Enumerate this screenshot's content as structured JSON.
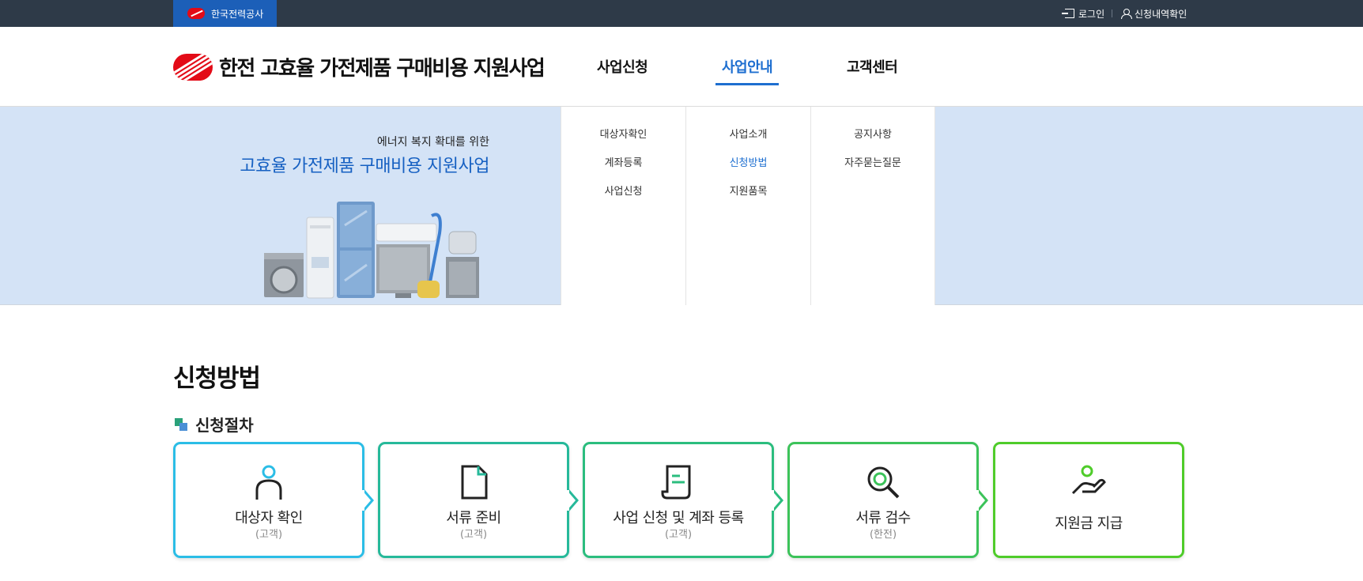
{
  "topbar": {
    "org": "한국전력공사",
    "login": "로그인",
    "history": "신청내역확인"
  },
  "header": {
    "logo_text": "한전 고효율 가전제품 구매비용 지원사업",
    "nav": [
      "사업신청",
      "사업안내",
      "고객센터"
    ],
    "active_nav": "사업안내"
  },
  "banner": {
    "subtitle": "에너지 복지 확대를 위한",
    "title": "고효율 가전제품 구매비용 지원사업"
  },
  "mega_menu": [
    [
      "대상자확인",
      "계좌등록",
      "사업신청"
    ],
    [
      "사업소개",
      "신청방법",
      "지원품목"
    ],
    [
      "공지사항",
      "자주묻는질문"
    ]
  ],
  "active_submenu": "신청방법",
  "page": {
    "title": "신청방법",
    "section": "신청절차"
  },
  "steps": [
    {
      "label": "대상자 확인",
      "sub": "(고객)",
      "color": "#2bbde6",
      "icon": "person-icon"
    },
    {
      "label": "서류 준비",
      "sub": "(고객)",
      "color": "#26b99a",
      "icon": "document-icon"
    },
    {
      "label": "사업 신청 및 계좌 등록",
      "sub": "(고객)",
      "color": "#2bbd7e",
      "icon": "receipt-icon"
    },
    {
      "label": "서류 검수",
      "sub": "(한전)",
      "color": "#3cc35a",
      "icon": "magnifier-icon"
    },
    {
      "label": "지원금 지급",
      "sub": "",
      "color": "#4fcc2a",
      "icon": "hand-coin-icon"
    }
  ],
  "colors": {
    "topbar": "#2e3a48",
    "brand_blue": "#1e6fd0",
    "kepco_red": "#e30b17",
    "banner_bg": "#d4e3f6"
  }
}
